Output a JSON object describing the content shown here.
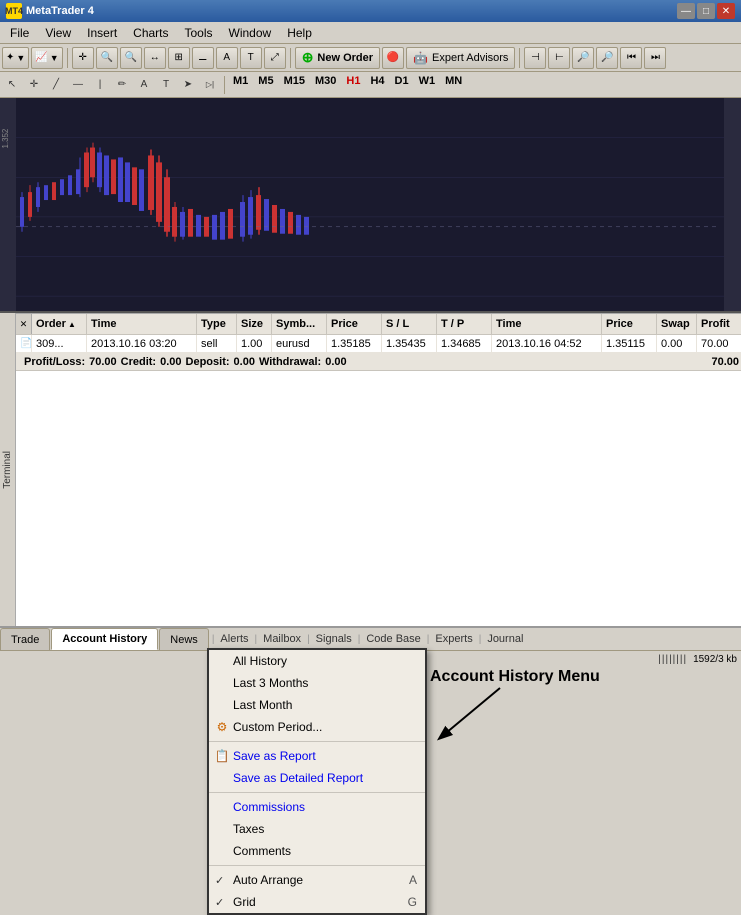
{
  "titleBar": {
    "title": "MetaTrader 4",
    "icon": "MT4",
    "minimizeLabel": "—",
    "maximizeLabel": "□",
    "closeLabel": "✕"
  },
  "menuBar": {
    "items": [
      "File",
      "View",
      "Insert",
      "Charts",
      "Tools",
      "Window",
      "Help"
    ]
  },
  "toolbar": {
    "newOrderLabel": "New Order",
    "expertAdvisorsLabel": "Expert Advisors"
  },
  "timeframes": [
    "M1",
    "M5",
    "M15",
    "M30",
    "H1",
    "H4",
    "D1",
    "W1",
    "MN"
  ],
  "activeTimeframe": "H1",
  "tableHeaders": {
    "order": "Order",
    "time": "Time",
    "type": "Type",
    "size": "Size",
    "symbol": "Symb...",
    "price": "Price",
    "sl": "S / L",
    "tp": "T / P",
    "time2": "Time",
    "price2": "Price",
    "swap": "Swap",
    "profit": "Profit"
  },
  "tableRow": {
    "orderIcon": "📄",
    "order": "309...",
    "time": "2013.10.16 03:20",
    "type": "sell",
    "size": "1.00",
    "symbol": "eurusd",
    "price": "1.35185",
    "sl": "1.35435",
    "tp": "1.34685",
    "time2": "2013.10.16 04:52",
    "price2": "1.35115",
    "swap": "0.00",
    "profit": "70.00"
  },
  "summaryRow": {
    "plLabel": "Profit/Loss:",
    "plValue": "70.00",
    "creditLabel": "Credit:",
    "creditValue": "0.00",
    "depositLabel": "Deposit:",
    "depositValue": "0.00",
    "withdrawalLabel": "Withdrawal:",
    "withdrawalValue": "0.00",
    "total": "70.00"
  },
  "contextMenu": {
    "items": [
      {
        "id": "all-history",
        "label": "All History",
        "type": "normal"
      },
      {
        "id": "last-3-months",
        "label": "Last 3 Months",
        "type": "normal"
      },
      {
        "id": "last-month",
        "label": "Last Month",
        "type": "normal"
      },
      {
        "id": "custom-period",
        "label": "Custom Period...",
        "type": "icon",
        "icon": "🔧"
      },
      {
        "id": "sep1",
        "type": "separator"
      },
      {
        "id": "save-report",
        "label": "Save as Report",
        "type": "icon-blue",
        "icon": "📋"
      },
      {
        "id": "save-detailed",
        "label": "Save as Detailed Report",
        "type": "blue"
      },
      {
        "id": "sep2",
        "type": "separator"
      },
      {
        "id": "commissions",
        "label": "Commissions",
        "type": "blue"
      },
      {
        "id": "taxes",
        "label": "Taxes",
        "type": "normal"
      },
      {
        "id": "comments",
        "label": "Comments",
        "type": "normal"
      },
      {
        "id": "sep3",
        "type": "separator"
      },
      {
        "id": "auto-arrange",
        "label": "Auto Arrange",
        "type": "checked",
        "shortcut": "A"
      },
      {
        "id": "grid",
        "label": "Grid",
        "type": "checked",
        "shortcut": "G"
      }
    ]
  },
  "annotation": {
    "text": "Account History Menu"
  },
  "bottomTabs": {
    "tabs": [
      "Trade",
      "Account History",
      "News",
      "Alerts",
      "Mailbox",
      "Signals",
      "Code Base",
      "Experts",
      "Journal"
    ]
  },
  "activeTab": "Account History",
  "statusBar": {
    "terminalLabel": "Terminal",
    "memoryLabel": "1592/3 kb",
    "barIndicator": "||||||||"
  }
}
